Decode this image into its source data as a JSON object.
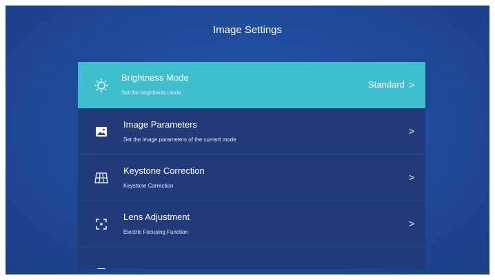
{
  "page": {
    "title": "Image Settings"
  },
  "menu": {
    "items": [
      {
        "label": "Brightness Mode",
        "sub": "Set the brightness mode",
        "value": "Standard",
        "icon": "sun-icon",
        "active": true
      },
      {
        "label": "Image Parameters",
        "sub": "Set the image parameters of the current mode",
        "value": "",
        "icon": "image-icon",
        "active": false
      },
      {
        "label": "Keystone Correction",
        "sub": "Keystone Correction",
        "value": "",
        "icon": "grid-icon",
        "active": false
      },
      {
        "label": "Lens Adjustment",
        "sub": "Electric Focusing Function",
        "value": "",
        "icon": "focus-icon",
        "active": false
      }
    ],
    "chevron": ">"
  },
  "colors": {
    "accent": "#3fbecd",
    "row_bg": "#203a7a",
    "background": "#214c9d"
  }
}
